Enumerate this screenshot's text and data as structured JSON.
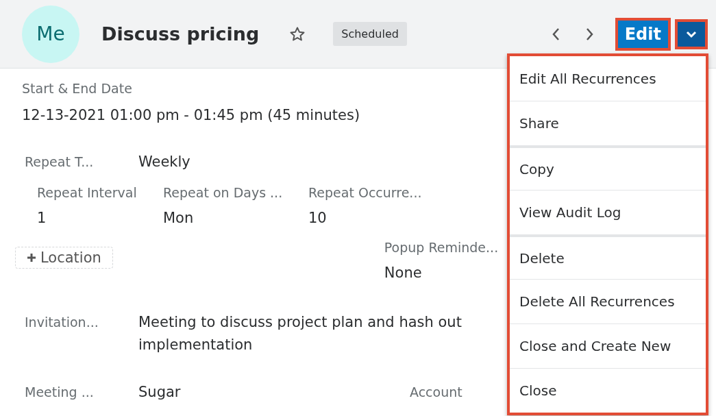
{
  "header": {
    "avatar": "Me",
    "title": "Discuss pricing",
    "favorite": false,
    "status": "Scheduled",
    "edit_button": "Edit"
  },
  "start_end": {
    "label": "Start & End Date",
    "value": "12-13-2021 01:00 pm - 01:45 pm (45 minutes)"
  },
  "repeat_type": {
    "label": "Repeat T...",
    "value": "Weekly"
  },
  "repeat_fields": [
    {
      "label": "Repeat Interval",
      "value": "1"
    },
    {
      "label": "Repeat on Days ...",
      "value": "Mon"
    },
    {
      "label": "Repeat Occurre...",
      "value": "10"
    }
  ],
  "location_button": "Location",
  "popup_reminder": {
    "label": "Popup Reminde...",
    "value": "None"
  },
  "invitation": {
    "label": "Invitation...",
    "value": "Meeting to discuss project plan and hash out implementation"
  },
  "meeting": {
    "label": "Meeting ...",
    "value": "Sugar"
  },
  "account": {
    "label": "Account"
  },
  "menu_groups": [
    [
      "Edit All Recurrences",
      "Share"
    ],
    [
      "Copy",
      "View Audit Log"
    ],
    [
      "Delete",
      "Delete All Recurrences",
      "Close and Create New",
      "Close"
    ]
  ]
}
